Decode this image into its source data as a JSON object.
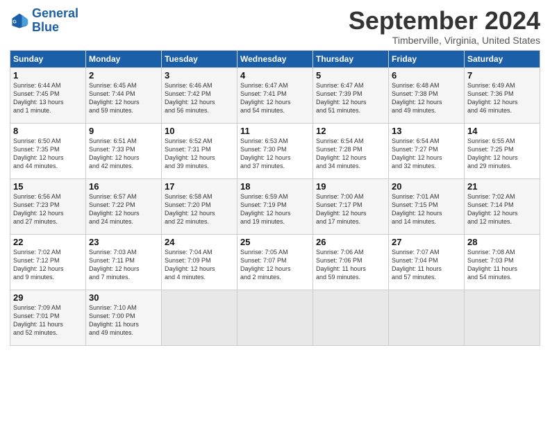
{
  "logo": {
    "line1": "General",
    "line2": "Blue"
  },
  "title": "September 2024",
  "subtitle": "Timberville, Virginia, United States",
  "days_header": [
    "Sunday",
    "Monday",
    "Tuesday",
    "Wednesday",
    "Thursday",
    "Friday",
    "Saturday"
  ],
  "weeks": [
    [
      {
        "day": "1",
        "lines": [
          "Sunrise: 6:44 AM",
          "Sunset: 7:45 PM",
          "Daylight: 13 hours",
          "and 1 minute."
        ]
      },
      {
        "day": "2",
        "lines": [
          "Sunrise: 6:45 AM",
          "Sunset: 7:44 PM",
          "Daylight: 12 hours",
          "and 59 minutes."
        ]
      },
      {
        "day": "3",
        "lines": [
          "Sunrise: 6:46 AM",
          "Sunset: 7:42 PM",
          "Daylight: 12 hours",
          "and 56 minutes."
        ]
      },
      {
        "day": "4",
        "lines": [
          "Sunrise: 6:47 AM",
          "Sunset: 7:41 PM",
          "Daylight: 12 hours",
          "and 54 minutes."
        ]
      },
      {
        "day": "5",
        "lines": [
          "Sunrise: 6:47 AM",
          "Sunset: 7:39 PM",
          "Daylight: 12 hours",
          "and 51 minutes."
        ]
      },
      {
        "day": "6",
        "lines": [
          "Sunrise: 6:48 AM",
          "Sunset: 7:38 PM",
          "Daylight: 12 hours",
          "and 49 minutes."
        ]
      },
      {
        "day": "7",
        "lines": [
          "Sunrise: 6:49 AM",
          "Sunset: 7:36 PM",
          "Daylight: 12 hours",
          "and 46 minutes."
        ]
      }
    ],
    [
      {
        "day": "8",
        "lines": [
          "Sunrise: 6:50 AM",
          "Sunset: 7:35 PM",
          "Daylight: 12 hours",
          "and 44 minutes."
        ]
      },
      {
        "day": "9",
        "lines": [
          "Sunrise: 6:51 AM",
          "Sunset: 7:33 PM",
          "Daylight: 12 hours",
          "and 42 minutes."
        ]
      },
      {
        "day": "10",
        "lines": [
          "Sunrise: 6:52 AM",
          "Sunset: 7:31 PM",
          "Daylight: 12 hours",
          "and 39 minutes."
        ]
      },
      {
        "day": "11",
        "lines": [
          "Sunrise: 6:53 AM",
          "Sunset: 7:30 PM",
          "Daylight: 12 hours",
          "and 37 minutes."
        ]
      },
      {
        "day": "12",
        "lines": [
          "Sunrise: 6:54 AM",
          "Sunset: 7:28 PM",
          "Daylight: 12 hours",
          "and 34 minutes."
        ]
      },
      {
        "day": "13",
        "lines": [
          "Sunrise: 6:54 AM",
          "Sunset: 7:27 PM",
          "Daylight: 12 hours",
          "and 32 minutes."
        ]
      },
      {
        "day": "14",
        "lines": [
          "Sunrise: 6:55 AM",
          "Sunset: 7:25 PM",
          "Daylight: 12 hours",
          "and 29 minutes."
        ]
      }
    ],
    [
      {
        "day": "15",
        "lines": [
          "Sunrise: 6:56 AM",
          "Sunset: 7:23 PM",
          "Daylight: 12 hours",
          "and 27 minutes."
        ]
      },
      {
        "day": "16",
        "lines": [
          "Sunrise: 6:57 AM",
          "Sunset: 7:22 PM",
          "Daylight: 12 hours",
          "and 24 minutes."
        ]
      },
      {
        "day": "17",
        "lines": [
          "Sunrise: 6:58 AM",
          "Sunset: 7:20 PM",
          "Daylight: 12 hours",
          "and 22 minutes."
        ]
      },
      {
        "day": "18",
        "lines": [
          "Sunrise: 6:59 AM",
          "Sunset: 7:19 PM",
          "Daylight: 12 hours",
          "and 19 minutes."
        ]
      },
      {
        "day": "19",
        "lines": [
          "Sunrise: 7:00 AM",
          "Sunset: 7:17 PM",
          "Daylight: 12 hours",
          "and 17 minutes."
        ]
      },
      {
        "day": "20",
        "lines": [
          "Sunrise: 7:01 AM",
          "Sunset: 7:15 PM",
          "Daylight: 12 hours",
          "and 14 minutes."
        ]
      },
      {
        "day": "21",
        "lines": [
          "Sunrise: 7:02 AM",
          "Sunset: 7:14 PM",
          "Daylight: 12 hours",
          "and 12 minutes."
        ]
      }
    ],
    [
      {
        "day": "22",
        "lines": [
          "Sunrise: 7:02 AM",
          "Sunset: 7:12 PM",
          "Daylight: 12 hours",
          "and 9 minutes."
        ]
      },
      {
        "day": "23",
        "lines": [
          "Sunrise: 7:03 AM",
          "Sunset: 7:11 PM",
          "Daylight: 12 hours",
          "and 7 minutes."
        ]
      },
      {
        "day": "24",
        "lines": [
          "Sunrise: 7:04 AM",
          "Sunset: 7:09 PM",
          "Daylight: 12 hours",
          "and 4 minutes."
        ]
      },
      {
        "day": "25",
        "lines": [
          "Sunrise: 7:05 AM",
          "Sunset: 7:07 PM",
          "Daylight: 12 hours",
          "and 2 minutes."
        ]
      },
      {
        "day": "26",
        "lines": [
          "Sunrise: 7:06 AM",
          "Sunset: 7:06 PM",
          "Daylight: 11 hours",
          "and 59 minutes."
        ]
      },
      {
        "day": "27",
        "lines": [
          "Sunrise: 7:07 AM",
          "Sunset: 7:04 PM",
          "Daylight: 11 hours",
          "and 57 minutes."
        ]
      },
      {
        "day": "28",
        "lines": [
          "Sunrise: 7:08 AM",
          "Sunset: 7:03 PM",
          "Daylight: 11 hours",
          "and 54 minutes."
        ]
      }
    ],
    [
      {
        "day": "29",
        "lines": [
          "Sunrise: 7:09 AM",
          "Sunset: 7:01 PM",
          "Daylight: 11 hours",
          "and 52 minutes."
        ]
      },
      {
        "day": "30",
        "lines": [
          "Sunrise: 7:10 AM",
          "Sunset: 7:00 PM",
          "Daylight: 11 hours",
          "and 49 minutes."
        ]
      },
      {
        "day": "",
        "lines": []
      },
      {
        "day": "",
        "lines": []
      },
      {
        "day": "",
        "lines": []
      },
      {
        "day": "",
        "lines": []
      },
      {
        "day": "",
        "lines": []
      }
    ]
  ]
}
